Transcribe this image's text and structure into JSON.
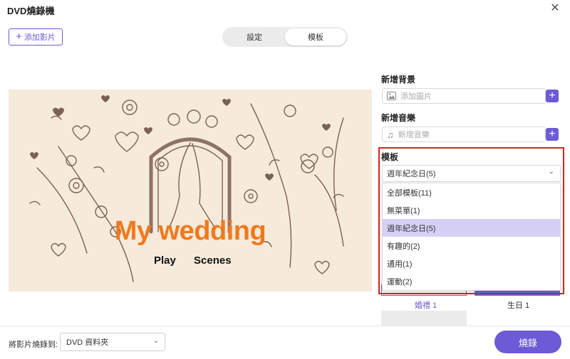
{
  "window": {
    "title": "DVD燒錄機",
    "close_icon": "close-icon"
  },
  "toolbar": {
    "add_video_label": "添加影片"
  },
  "tabs": [
    {
      "label": "設定"
    },
    {
      "label": "模板"
    }
  ],
  "preview": {
    "headline": "My wedding",
    "menu_items": [
      "Play",
      "Scenes"
    ],
    "colors": {
      "background": "#f6eadb",
      "headline": "#f07a1e",
      "decor": "#7a6156"
    }
  },
  "background_section": {
    "label": "新增背景",
    "placeholder": "添加圖片"
  },
  "music_section": {
    "label": "新增音樂",
    "placeholder": "新增音樂"
  },
  "template_section": {
    "label": "模板",
    "selected": "週年紀念日(5)",
    "options": [
      "全部模板(11)",
      "無菜單(1)",
      "週年紀念日(5)",
      "有趣的(2)",
      "通用(1)",
      "運動(2)"
    ]
  },
  "thumbnails": [
    {
      "label": "婚禮 1"
    },
    {
      "label": "生日 1"
    }
  ],
  "footer": {
    "burn_to_label": "將影片燒錄到:",
    "destination": "DVD 資料夾",
    "burn_button": "燒錄"
  },
  "colors": {
    "accent": "#6b5bd6",
    "highlight_box": "#e02020",
    "selected_option": "#d6d0f7"
  }
}
